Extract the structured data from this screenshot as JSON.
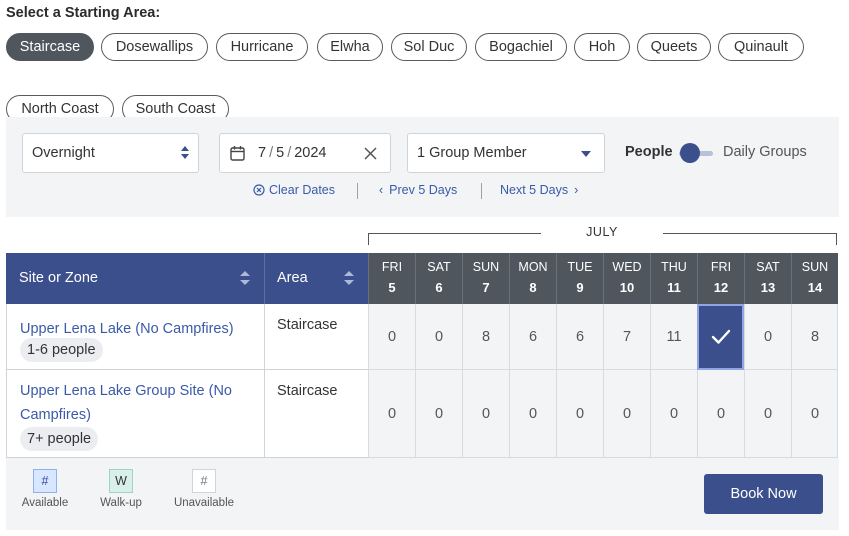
{
  "heading": "Select a Starting Area:",
  "areas": [
    {
      "label": "Staircase",
      "selected": true
    },
    {
      "label": "Dosewallips",
      "selected": false
    },
    {
      "label": "Hurricane",
      "selected": false
    },
    {
      "label": "Elwha",
      "selected": false
    },
    {
      "label": "Sol Duc",
      "selected": false
    },
    {
      "label": "Bogachiel",
      "selected": false
    },
    {
      "label": "Hoh",
      "selected": false
    },
    {
      "label": "Queets",
      "selected": false
    },
    {
      "label": "Quinault",
      "selected": false
    },
    {
      "label": "North Coast",
      "selected": false
    },
    {
      "label": "South Coast",
      "selected": false
    }
  ],
  "filters": {
    "trip_type": "Overnight",
    "date": {
      "month": "7",
      "day": "5",
      "year": "2024",
      "sep": "/"
    },
    "group_size": "1 Group Member",
    "toggle": {
      "left_label": "People",
      "right_label": "Daily Groups"
    },
    "clear_dates": "Clear Dates",
    "prev_days": "Prev 5 Days",
    "next_days": "Next 5 Days"
  },
  "table": {
    "month": "JULY",
    "col_site": "Site or Zone",
    "col_area": "Area",
    "days": [
      {
        "dow": "FRI",
        "num": "5"
      },
      {
        "dow": "SAT",
        "num": "6"
      },
      {
        "dow": "SUN",
        "num": "7"
      },
      {
        "dow": "MON",
        "num": "8"
      },
      {
        "dow": "TUE",
        "num": "9"
      },
      {
        "dow": "WED",
        "num": "10"
      },
      {
        "dow": "THU",
        "num": "11"
      },
      {
        "dow": "FRI",
        "num": "12"
      },
      {
        "dow": "SAT",
        "num": "13"
      },
      {
        "dow": "SUN",
        "num": "14"
      }
    ],
    "rows": [
      {
        "site": "Upper Lena Lake (No Campfires)",
        "capacity": "1-6 people",
        "area": "Staircase",
        "values": [
          "0",
          "0",
          "8",
          "6",
          "6",
          "7",
          "11",
          "",
          "0",
          "8"
        ],
        "selected_index": 7
      },
      {
        "site": "Upper Lena Lake Group Site (No Campfires)",
        "capacity": "7+ people",
        "area": "Staircase",
        "values": [
          "0",
          "0",
          "0",
          "0",
          "0",
          "0",
          "0",
          "0",
          "0",
          "0"
        ],
        "selected_index": -1
      }
    ]
  },
  "legend": [
    {
      "symbol": "#",
      "label": "Available",
      "bg": "#d9e6ff",
      "border": "#8fb1f0",
      "color": "#2c4a99"
    },
    {
      "symbol": "W",
      "label": "Walk-up",
      "bg": "#d9f0ea",
      "border": "#9fd3c4",
      "color": "#333333"
    },
    {
      "symbol": "#",
      "label": "Unavailable",
      "bg": "#ffffff",
      "border": "#cfd4d9",
      "color": "#777777"
    }
  ],
  "book_now": "Book Now",
  "colors": {
    "primary": "#3b4f8c",
    "chip_active": "#4f565e",
    "link": "#3a5aa8",
    "panel": "#f2f4f6"
  }
}
